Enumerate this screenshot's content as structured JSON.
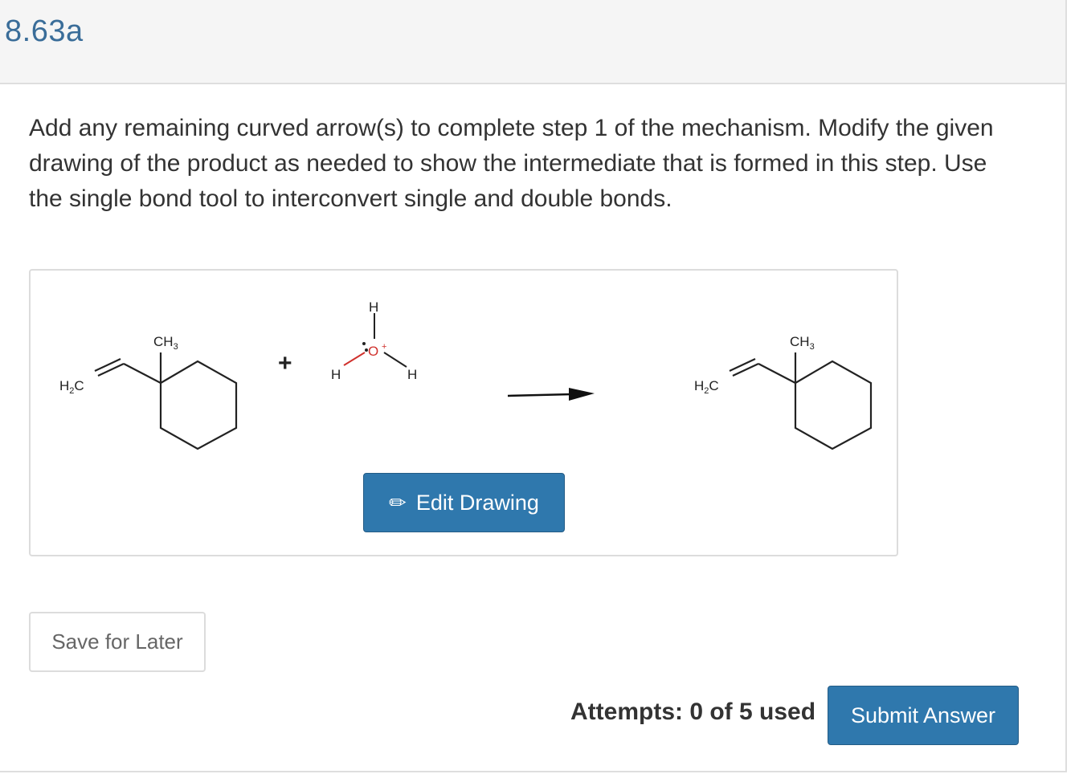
{
  "question": {
    "id": "8.63a",
    "prompt": "Add any remaining curved arrow(s) to complete step 1 of the mechanism. Modify the given drawing of the product as needed to show the intermediate that is formed in this step. Use the single bond tool to interconvert single and double bonds."
  },
  "drawing": {
    "reactant": {
      "methyl_label": "CH",
      "methyl_sub": "3",
      "vinyl_label_h": "H",
      "vinyl_sub": "2",
      "vinyl_label_c": "C"
    },
    "plus_sign": "+",
    "hydronium": {
      "h_top": "H",
      "h_left": "H",
      "h_right": "H",
      "oxygen": "O",
      "charge": "+",
      "oxygen_color": "#d0312d"
    },
    "product": {
      "methyl_label": "CH",
      "methyl_sub": "3",
      "vinyl_label_h": "H",
      "vinyl_sub": "2",
      "vinyl_label_c": "C"
    },
    "edit_button": {
      "icon": "pencil-icon",
      "label": "Edit Drawing"
    }
  },
  "actions": {
    "save_label": "Save for Later",
    "attempts_text": "Attempts: 0 of 5 used",
    "submit_label": "Submit Answer"
  },
  "colors": {
    "accent": "#2f78ad",
    "title": "#3a6d99",
    "text": "#333333"
  }
}
